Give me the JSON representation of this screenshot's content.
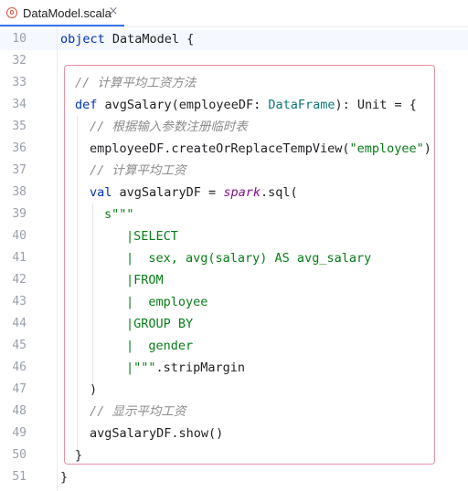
{
  "tab": {
    "filename": "DataModel.scala",
    "icon": "scala-file-icon",
    "close": "×"
  },
  "colors": {
    "keyword": "#0033b3",
    "type": "#0d7878",
    "string": "#067d17",
    "comment": "#8c8c8c",
    "method": "#871094",
    "highlight_box": "#e78fa2"
  },
  "editor": {
    "lines": [
      {
        "num": "10",
        "tokens": [
          "object",
          " DataModel {"
        ]
      },
      {
        "num": "32"
      },
      {
        "num": "33",
        "tokens": [
          "// 计算平均工资方法"
        ]
      },
      {
        "num": "34",
        "tokens": [
          "def",
          " avgSalary(employeeDF: ",
          "DataFrame",
          "): Unit = {"
        ]
      },
      {
        "num": "35",
        "tokens": [
          "// 根据输入参数注册临时表"
        ]
      },
      {
        "num": "36",
        "tokens": [
          "employeeDF.createOrReplaceTempView(",
          "\"employee\"",
          ")"
        ]
      },
      {
        "num": "37",
        "tokens": [
          "// 计算平均工资"
        ]
      },
      {
        "num": "38",
        "tokens": [
          "val",
          " avgSalaryDF = ",
          "spark",
          ".sql("
        ]
      },
      {
        "num": "39",
        "tokens": [
          "s\"\"\""
        ]
      },
      {
        "num": "40",
        "tokens": [
          "|SELECT"
        ]
      },
      {
        "num": "41",
        "tokens": [
          "|  sex, avg(salary) AS avg_salary"
        ]
      },
      {
        "num": "42",
        "tokens": [
          "|FROM"
        ]
      },
      {
        "num": "43",
        "tokens": [
          "|  employee"
        ]
      },
      {
        "num": "44",
        "tokens": [
          "|GROUP BY"
        ]
      },
      {
        "num": "45",
        "tokens": [
          "|  gender"
        ]
      },
      {
        "num": "46",
        "tokens": [
          "|\"\"\"",
          ".stripMargin"
        ]
      },
      {
        "num": "47",
        "tokens": [
          ")"
        ]
      },
      {
        "num": "48",
        "tokens": [
          "// 显示平均工资"
        ]
      },
      {
        "num": "49",
        "tokens": [
          "avgSalaryDF.show()"
        ]
      },
      {
        "num": "50",
        "tokens": [
          "}"
        ]
      },
      {
        "num": "51",
        "tokens": [
          "}"
        ]
      }
    ]
  }
}
